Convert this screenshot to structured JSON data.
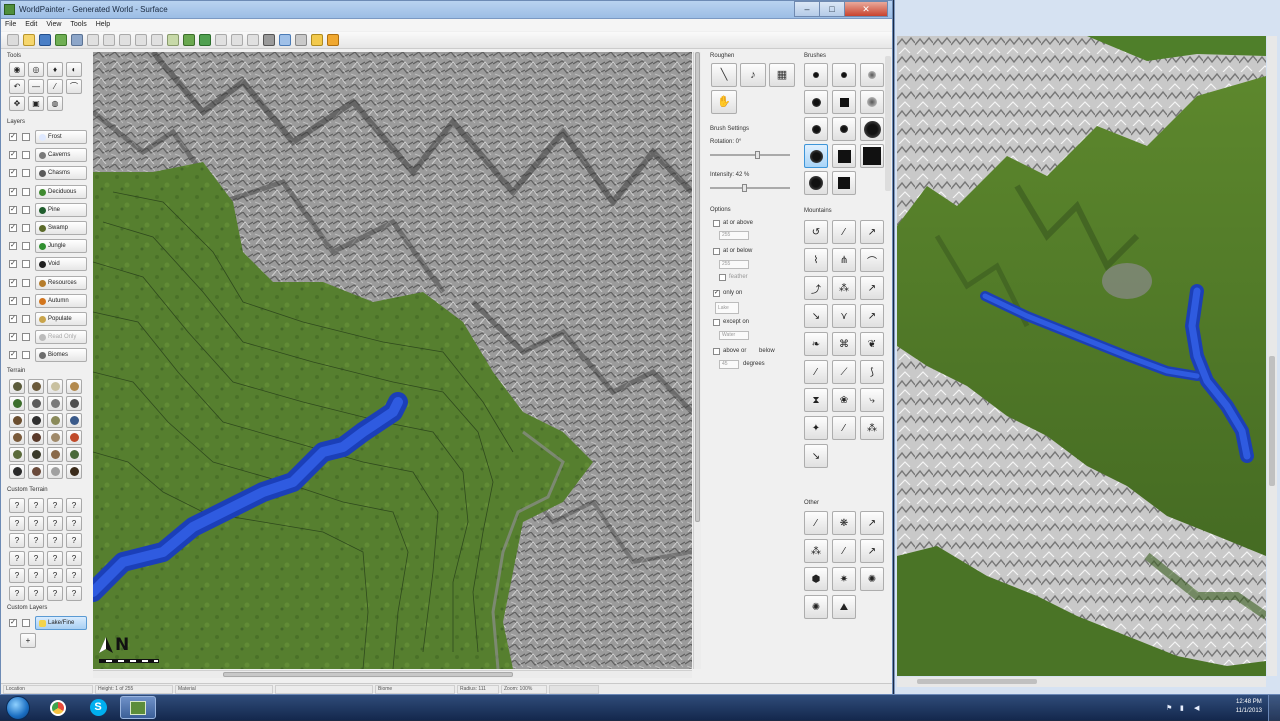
{
  "window": {
    "title": "WorldPainter - Generated World - Surface",
    "controls": [
      "–",
      "□",
      "✕"
    ]
  },
  "menu": [
    "File",
    "Edit",
    "View",
    "Tools",
    "Help"
  ],
  "left_panel": {
    "tools_label": "Tools",
    "layers_label": "Layers",
    "terrain_label": "Terrain",
    "custom_terrain_label": "Custom Terrain",
    "custom_layers_label": "Custom Layers",
    "layers": [
      {
        "label": "Frost",
        "icon_color": "#dfe9ff"
      },
      {
        "label": "Caverns",
        "icon_color": "#7a7a7a"
      },
      {
        "label": "Chasms",
        "icon_color": "#5a5a5a"
      },
      {
        "label": "Deciduous",
        "icon_color": "#3f8a2f"
      },
      {
        "label": "Pine",
        "icon_color": "#1f5d2c"
      },
      {
        "label": "Swamp",
        "icon_color": "#5c6b2a"
      },
      {
        "label": "Jungle",
        "icon_color": "#2f8f2f"
      },
      {
        "label": "Void",
        "icon_color": "#202020"
      },
      {
        "label": "Resources",
        "icon_color": "#b57c2c"
      },
      {
        "label": "Autumn",
        "icon_color": "#d2751d"
      },
      {
        "label": "Populate",
        "icon_color": "#c9a44b"
      },
      {
        "label": "Read Only",
        "icon_color": "#bbbbbb"
      },
      {
        "label": "Biomes",
        "icon_color": "#6d6d6d"
      }
    ],
    "custom_layer": {
      "label": "Lake/Fine",
      "icon_color": "#f3d34a"
    },
    "add_button": "+",
    "unknown_glyph": "?"
  },
  "settings_panel": {
    "roughen_label": "Roughen",
    "brush_settings_label": "Brush Settings",
    "rotation_label": "Rotation: 0°",
    "rotation_value": 0.6,
    "intensity_label": "Intensity: 42 %",
    "intensity_value": 0.42,
    "options_label": "Options",
    "options": [
      {
        "label": "at or above",
        "checked": false,
        "spin": "255"
      },
      {
        "label": "at or below",
        "checked": false,
        "spin": "255"
      },
      {
        "label": "feather",
        "checked": false,
        "dim": true
      },
      {
        "label": "only on",
        "checked": true,
        "spin": "Lake"
      },
      {
        "label": "except on",
        "checked": false,
        "spin": "Water"
      },
      {
        "label": "above or",
        "checked": false,
        "suffix": "below"
      },
      {
        "label": "degrees",
        "spin": "45"
      }
    ]
  },
  "brushes_panel": {
    "brushes_label": "Brushes",
    "mountains_label": "Mountains",
    "other_label": "Other"
  },
  "status_bar": {
    "location": "Location",
    "height": "Height: 1 of 255",
    "material": "Material",
    "biome": "Biome",
    "radius": "Radius: 111",
    "zoom": "Zoom: 100%"
  },
  "compass": {
    "letter": "N"
  },
  "taskbar": {
    "clock_time": "12:48 PM",
    "clock_date": "11/1/2013"
  }
}
